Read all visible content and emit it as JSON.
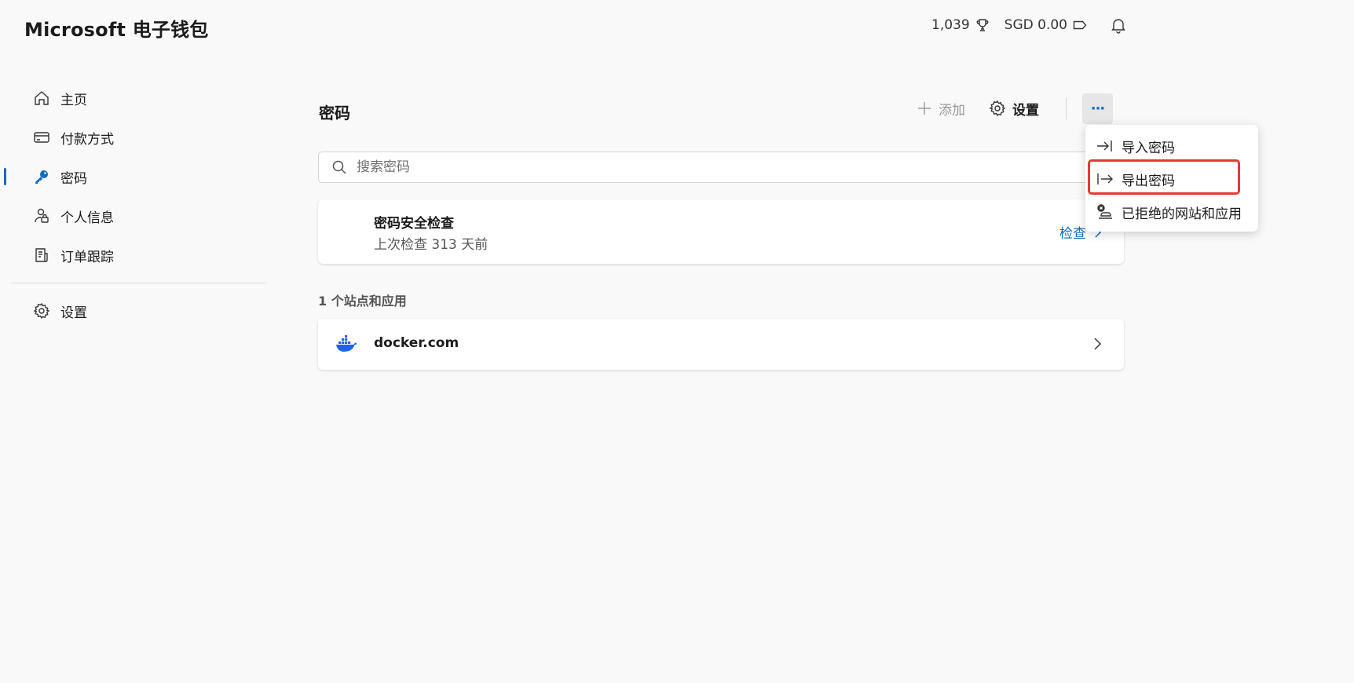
{
  "app": {
    "title": "Microsoft 电子钱包"
  },
  "header": {
    "points": "1,039",
    "balance": "SGD 0.00",
    "icons": {
      "points": "trophy-icon",
      "balance": "tag-icon",
      "notifications": "bell-icon"
    }
  },
  "sidebar": {
    "items": [
      {
        "label": "主页",
        "icon": "home-icon"
      },
      {
        "label": "付款方式",
        "icon": "card-icon"
      },
      {
        "label": "密码",
        "icon": "key-icon",
        "active": true
      },
      {
        "label": "个人信息",
        "icon": "person-icon"
      },
      {
        "label": "订单跟踪",
        "icon": "receipt-icon"
      }
    ],
    "settings": {
      "label": "设置",
      "icon": "gear-icon"
    }
  },
  "main": {
    "title": "密码",
    "toolbar": {
      "add_label": "添加",
      "settings_label": "设置",
      "more_label": "···"
    },
    "search": {
      "placeholder": "搜索密码",
      "value": ""
    },
    "security_check": {
      "title": "密码安全检查",
      "subtitle": "上次检查 313 天前",
      "action": "检查"
    },
    "sites_label": "1 个站点和应用",
    "sites": [
      {
        "name": "docker.com",
        "icon": "docker-icon"
      }
    ]
  },
  "menu": {
    "items": [
      {
        "label": "导入密码",
        "icon": "import-icon"
      },
      {
        "label": "导出密码",
        "icon": "export-icon"
      },
      {
        "label": "已拒绝的网站和应用",
        "icon": "blocked-sites-icon"
      }
    ]
  },
  "colors": {
    "accent": "#0f6cbd",
    "highlight": "#e53935",
    "background": "#f9f9f9"
  }
}
